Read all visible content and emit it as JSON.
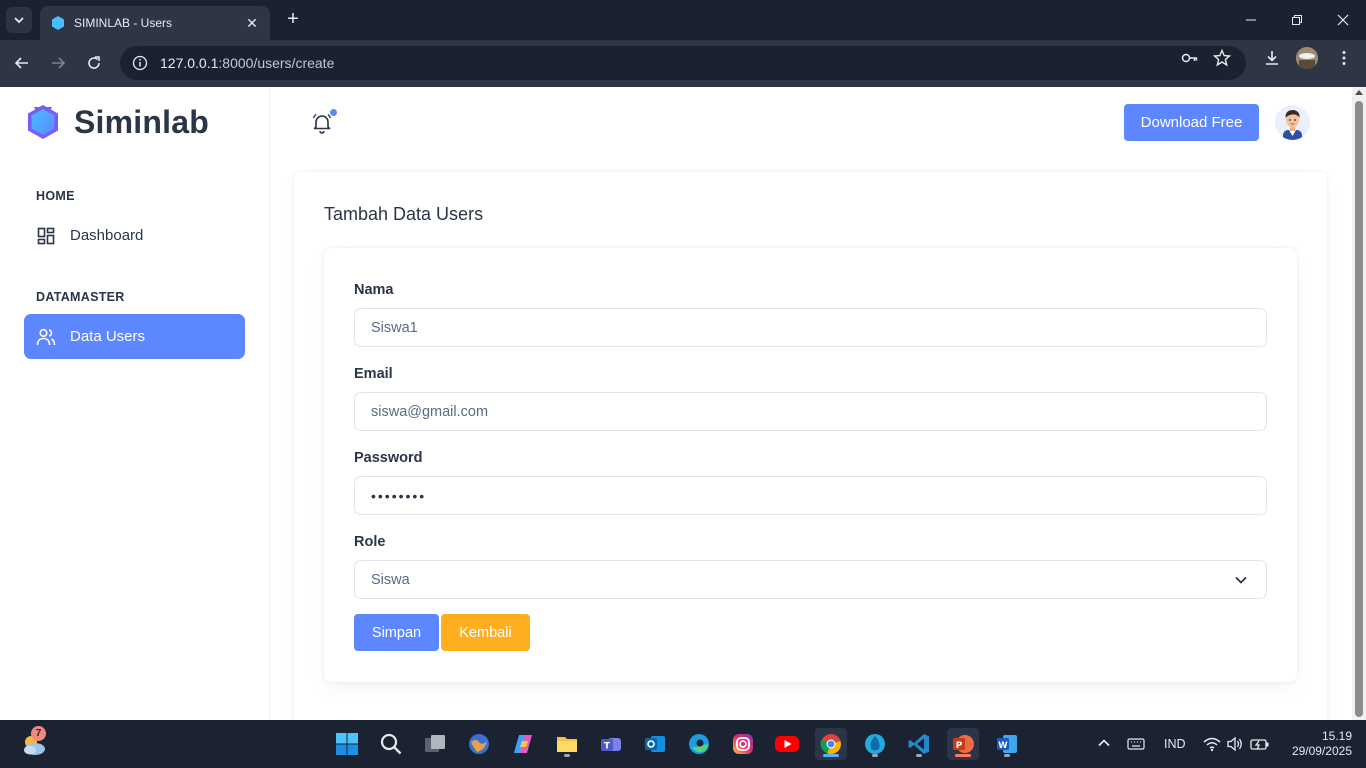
{
  "browser": {
    "tab_title": "SIMINLAB - Users",
    "url_host": "127.0.0.1",
    "url_path": ":8000/users/create"
  },
  "sidebar": {
    "brand": "Siminlab",
    "sections": [
      {
        "label": "HOME",
        "items": [
          {
            "label": "Dashboard",
            "icon": "dashboard-icon"
          }
        ]
      },
      {
        "label": "DATAMASTER",
        "items": [
          {
            "label": "Data Users",
            "icon": "users-icon",
            "active": true
          }
        ]
      }
    ]
  },
  "header": {
    "download_label": "Download Free"
  },
  "form": {
    "title": "Tambah Data Users",
    "nama": {
      "label": "Nama",
      "value": "Siswa1"
    },
    "email": {
      "label": "Email",
      "value": "siswa@gmail.com"
    },
    "password": {
      "label": "Password",
      "value": "••••••••"
    },
    "role": {
      "label": "Role",
      "value": "Siswa"
    },
    "save_label": "Simpan",
    "back_label": "Kembali"
  },
  "taskbar": {
    "weather_badge": "7",
    "language": "IND",
    "time": "15.19",
    "date": "29/09/2025"
  },
  "colors": {
    "primary": "#5d87ff",
    "warning": "#ffae1f",
    "text": "#2a3547"
  }
}
